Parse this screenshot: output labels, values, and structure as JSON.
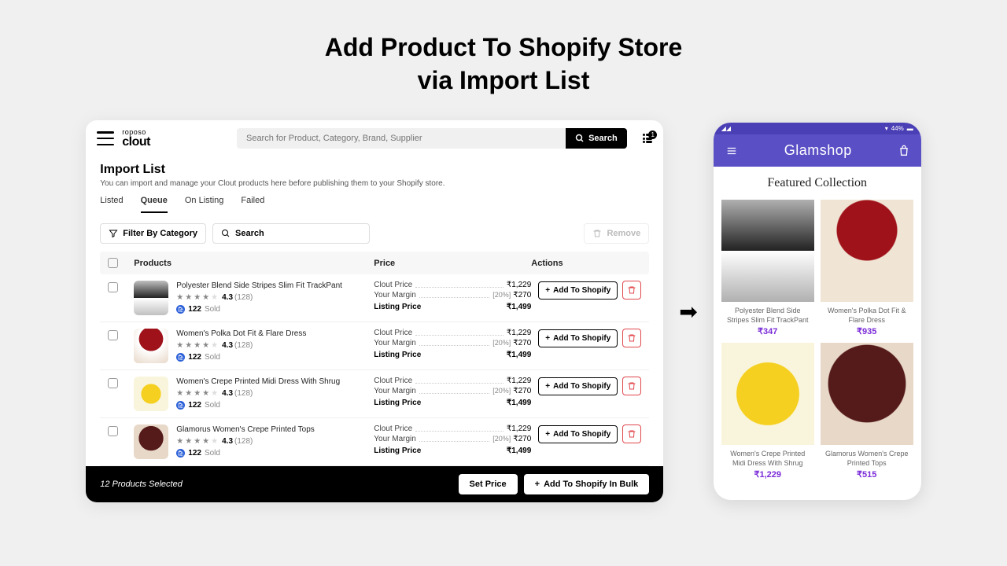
{
  "heading": {
    "line1": "Add Product To Shopify Store",
    "line2": "via Import List"
  },
  "logo": {
    "top": "roposo",
    "main": "clout"
  },
  "search": {
    "placeholder": "Search for Product, Category, Brand, Supplier",
    "button": "Search"
  },
  "notif": {
    "count": "1"
  },
  "page": {
    "title": "Import List",
    "subtitle": "You can import and manage your Clout products here before publishing them to your Shopify store."
  },
  "tabs": [
    "Listed",
    "Queue",
    "On Listing",
    "Failed"
  ],
  "toolbar": {
    "filter": "Filter By Category",
    "search": "Search",
    "remove": "Remove"
  },
  "columns": {
    "products": "Products",
    "price": "Price",
    "actions": "Actions"
  },
  "labels": {
    "clout": "Clout Price",
    "margin": "Your Margin",
    "listing": "Listing Price",
    "add": "Add To Shopify",
    "sold": "Sold"
  },
  "rows": [
    {
      "name": "Polyester Blend Side Stripes Slim Fit TrackPant",
      "rating": "4.3",
      "reviews": "(128)",
      "sold": "122",
      "clout": "₹1,229",
      "pct": "[20%]",
      "margin": "₹270",
      "listing": "₹1,499"
    },
    {
      "name": "Women's Polka Dot Fit & Flare Dress",
      "rating": "4.3",
      "reviews": "(128)",
      "sold": "122",
      "clout": "₹1,229",
      "pct": "[20%]",
      "margin": "₹270",
      "listing": "₹1,499"
    },
    {
      "name": "Women's Crepe Printed Midi Dress With Shrug",
      "rating": "4.3",
      "reviews": "(128)",
      "sold": "122",
      "clout": "₹1,229",
      "pct": "[20%]",
      "margin": "₹270",
      "listing": "₹1,499"
    },
    {
      "name": "Glamorus Women's Crepe Printed Tops",
      "rating": "4.3",
      "reviews": "(128)",
      "sold": "122",
      "clout": "₹1,229",
      "pct": "[20%]",
      "margin": "₹270",
      "listing": "₹1,499"
    }
  ],
  "footer": {
    "selected": "12 Products Selected",
    "setprice": "Set Price",
    "bulk": "Add To Shopify In Bulk"
  },
  "phone": {
    "battery": "44%",
    "brand": "Glamshop",
    "section": "Featured Collection"
  },
  "cards": [
    {
      "title": "Polyester Blend Side Stripes Slim Fit TrackPant",
      "price": "₹347"
    },
    {
      "title": "Women's Polka Dot Fit & Flare Dress",
      "price": "₹935"
    },
    {
      "title": "Women's Crepe Printed Midi Dress With Shrug",
      "price": "₹1,229"
    },
    {
      "title": "Glamorus Women's Crepe Printed Tops",
      "price": "₹515"
    }
  ]
}
